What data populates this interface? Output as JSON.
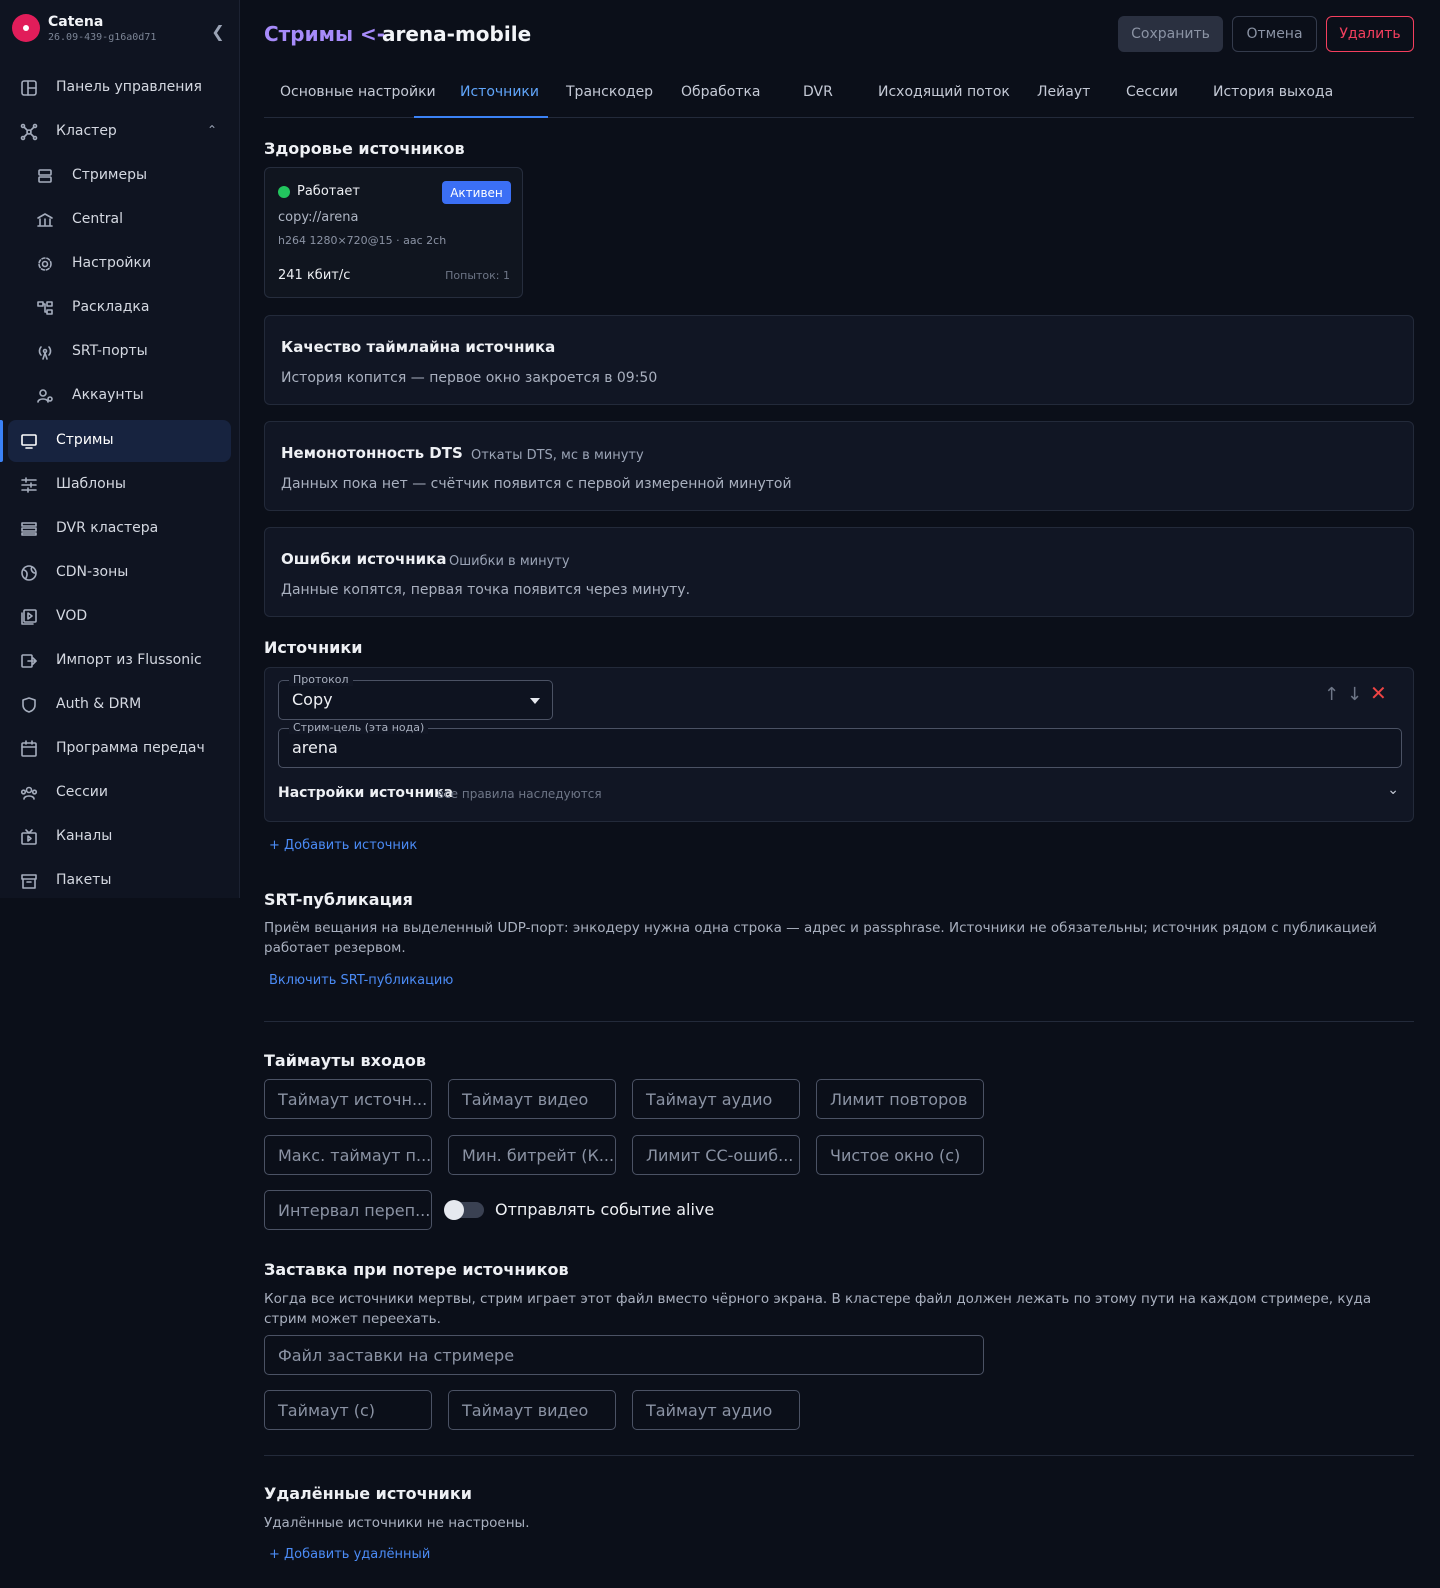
{
  "brand": {
    "name": "Catena",
    "version": "26.09-439-g16a0d71"
  },
  "sidebar": {
    "items": [
      {
        "label": "Панель управления",
        "icon": "dashboard-icon"
      },
      {
        "label": "Кластер",
        "icon": "cluster-icon"
      },
      {
        "label": "Стримеры",
        "icon": "server-icon"
      },
      {
        "label": "Central",
        "icon": "bank-icon"
      },
      {
        "label": "Настройки",
        "icon": "gear-icon"
      },
      {
        "label": "Раскладка",
        "icon": "layout-icon"
      },
      {
        "label": "SRT-порты",
        "icon": "antenna-icon"
      },
      {
        "label": "Аккаунты",
        "icon": "user-gear-icon"
      },
      {
        "label": "Стримы",
        "icon": "monitor-icon"
      },
      {
        "label": "Шаблоны",
        "icon": "sliders-icon"
      },
      {
        "label": "DVR кластера",
        "icon": "list-icon"
      },
      {
        "label": "CDN-зоны",
        "icon": "globe-icon"
      },
      {
        "label": "VOD",
        "icon": "video-library-icon"
      },
      {
        "label": "Импорт из Flussonic",
        "icon": "import-icon"
      },
      {
        "label": "Auth & DRM",
        "icon": "shield-icon"
      },
      {
        "label": "Программа передач",
        "icon": "calendar-icon"
      },
      {
        "label": "Сессии",
        "icon": "users-icon"
      },
      {
        "label": "Каналы",
        "icon": "tv-icon"
      },
      {
        "label": "Пакеты",
        "icon": "archive-icon"
      }
    ]
  },
  "header": {
    "crumb": "Стримы <-",
    "stream_name": "arena-mobile",
    "save": "Сохранить",
    "cancel": "Отмена",
    "delete": "Удалить"
  },
  "tabs": [
    "Основные настройки",
    "Источники",
    "Транскодер",
    "Обработка",
    "DVR",
    "Исходящий поток",
    "Лейаут",
    "Сессии",
    "История выхода"
  ],
  "health": {
    "title": "Здоровье источников",
    "status": "Работает",
    "badge": "Активен",
    "url": "copy://arena",
    "codec": "h264 1280×720@15 · aac 2ch",
    "bitrate": "241 кбит/с",
    "tries": "Попыток: 1"
  },
  "panels": {
    "timeline": {
      "title": "Качество таймлайна источника",
      "text": "История копится — первое окно закроется в 09:50"
    },
    "dts": {
      "title": "Немонотонность DTS",
      "sub": "Откаты DTS, мс в минуту",
      "text": "Данных пока нет — счётчик появится с первой измеренной минутой"
    },
    "errors": {
      "title": "Ошибки источника",
      "sub": "Ошибки в минуту",
      "text": "Данные копятся, первая точка появится через минуту."
    }
  },
  "sources": {
    "title": "Источники",
    "protocol_label": "Протокол",
    "protocol_value": "Copy",
    "target_label": "Стрим-цель (эта нода)",
    "target_value": "arena",
    "settings_label": "Настройки источника",
    "settings_note": "все правила наследуются",
    "add": "+ Добавить источник"
  },
  "srt": {
    "title": "SRT-публикация",
    "desc": "Приём вещания на выделенный UDP-порт: энкодеру нужна одна строка — адрес и passphrase. Источники не обязательны; источник рядом с публикацией работает резервом.",
    "enable": "Включить SRT-публикацию"
  },
  "timeouts": {
    "title": "Таймауты входов",
    "fields": [
      "Таймаут источн...",
      "Таймаут видео",
      "Таймаут аудио",
      "Лимит повторов",
      "Макс. таймаут п...",
      "Мин. битрейт (К...",
      "Лимит CC-ошиб...",
      "Чистое окно (с)",
      "Интервал переп..."
    ],
    "alive_label": "Отправлять событие alive"
  },
  "splash": {
    "title": "Заставка при потере источников",
    "desc": "Когда все источники мертвы, стрим играет этот файл вместо чёрного экрана. В кластере файл должен лежать по этому пути на каждом стримере, куда стрим может переехать.",
    "file_placeholder": "Файл заставки на стримере",
    "fields": [
      "Таймаут (с)",
      "Таймаут видео",
      "Таймаут аудио"
    ]
  },
  "remote": {
    "title": "Удалённые источники",
    "desc": "Удалённые источники не настроены.",
    "add": "+ Добавить удалённый"
  }
}
